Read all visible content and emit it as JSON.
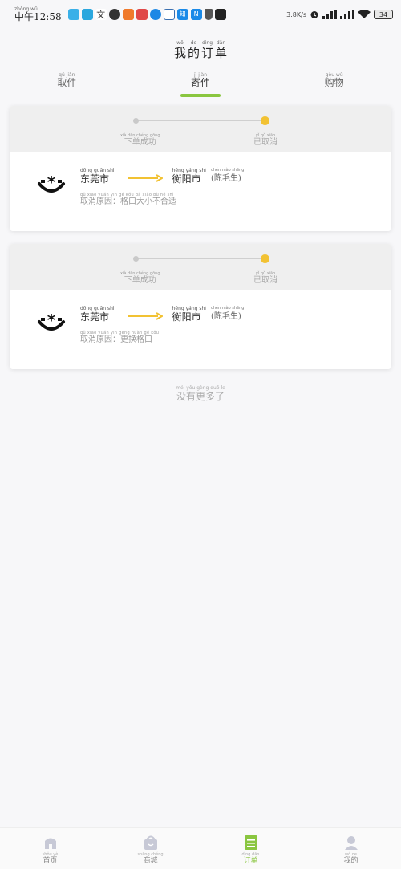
{
  "status_bar": {
    "time_pinyin": "zhōng wǔ",
    "time": "中午12:58",
    "speed": "3.8K/s",
    "battery": "34",
    "app_icons": [
      "weibo-icon",
      "skype-icon",
      "text-icon",
      "avatar-icon",
      "taobao-icon",
      "netease-icon",
      "gold-icon",
      "ship-icon",
      "zhihu-icon",
      "notion-icon",
      "shield-icon",
      "tiktok-icon"
    ],
    "app_icon_labels": [
      "",
      "",
      "文",
      "",
      "",
      "",
      "",
      "",
      "知",
      "N",
      "",
      ""
    ]
  },
  "header": {
    "title": [
      {
        "py": "wǒ",
        "hz": "我"
      },
      {
        "py": "de",
        "hz": "的"
      },
      {
        "py": "dìng",
        "hz": "订"
      },
      {
        "py": "dān",
        "hz": "单"
      }
    ]
  },
  "tabs": [
    {
      "py": "qǔ jiàn",
      "hz": "取件",
      "active": false
    },
    {
      "py": "jì jiàn",
      "hz": "寄件",
      "active": true
    },
    {
      "py": "gòu wù",
      "hz": "购物",
      "active": false
    }
  ],
  "orders": [
    {
      "step_start": {
        "py": "xià dān chéng gōng",
        "hz": "下单成功"
      },
      "step_end": {
        "py": "yǐ qǔ xiāo",
        "hz": "已取消"
      },
      "from": {
        "py": "dōng guǎn shì",
        "hz": "东莞市"
      },
      "to": {
        "py": "héng yáng shì",
        "hz": "衡阳市"
      },
      "person": {
        "py": "chén mào shēng",
        "hz": "(陈毛生)"
      },
      "reason": {
        "py": "qǔ xiāo yuán yīn   gé kǒu dà xiǎo bù hé shì",
        "hz": "取消原因：格口大小不合适"
      }
    },
    {
      "step_start": {
        "py": "xià dān chéng gōng",
        "hz": "下单成功"
      },
      "step_end": {
        "py": "yǐ qǔ xiāo",
        "hz": "已取消"
      },
      "from": {
        "py": "dōng guǎn shì",
        "hz": "东莞市"
      },
      "to": {
        "py": "héng yáng shì",
        "hz": "衡阳市"
      },
      "person": {
        "py": "chén mào shēng",
        "hz": "(陈毛生)"
      },
      "reason": {
        "py": "qǔ xiāo yuán yīn   gēng huàn gé kǒu",
        "hz": "取消原因：更换格口"
      }
    }
  ],
  "no_more": {
    "py": "méi yǒu gèng duō le",
    "hz": "没有更多了"
  },
  "nav": [
    {
      "py": "shǒu yè",
      "hz": "首页",
      "icon": "home-icon"
    },
    {
      "py": "shāng chéng",
      "hz": "商城",
      "icon": "shopping-bag-icon"
    },
    {
      "py": "dìng dān",
      "hz": "订单",
      "icon": "orders-icon",
      "active": true
    },
    {
      "py": "wǒ de",
      "hz": "我的",
      "icon": "profile-icon"
    }
  ],
  "colors": {
    "accent": "#8ac640",
    "progress_dot": "#f2c233",
    "arrow": "#f2c233"
  }
}
